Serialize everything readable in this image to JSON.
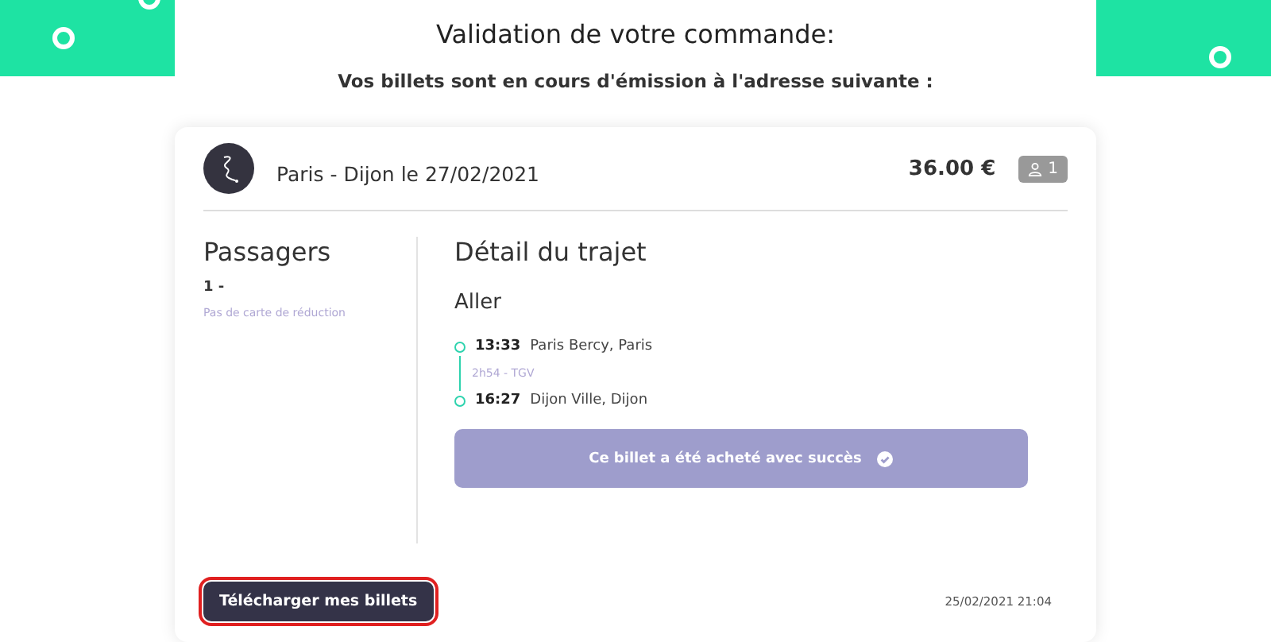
{
  "header": {
    "title": "Validation de votre commande:",
    "subtitle": "Vos billets sont en cours d'émission à l'adresse suivante :"
  },
  "order": {
    "route": "Paris - Dijon le 27/02/2021",
    "price": "36.00 €",
    "passenger_count": "1"
  },
  "passengers": {
    "title": "Passagers",
    "items": [
      {
        "name": "1 -",
        "discount": "Pas de carte de réduction"
      }
    ]
  },
  "trip": {
    "title": "Détail du trajet",
    "direction": "Aller",
    "stops": [
      {
        "time": "13:33",
        "station": "Paris Bercy, Paris"
      },
      {
        "time": "16:27",
        "station": "Dijon Ville, Dijon"
      }
    ],
    "segment": "2h54 - TGV",
    "status": "Ce billet a été acheté avec succès"
  },
  "footer": {
    "download_button": {
      "label": "Télécharger mes billets",
      "highlighted": true
    },
    "timestamp": "25/02/2021 21:04"
  }
}
